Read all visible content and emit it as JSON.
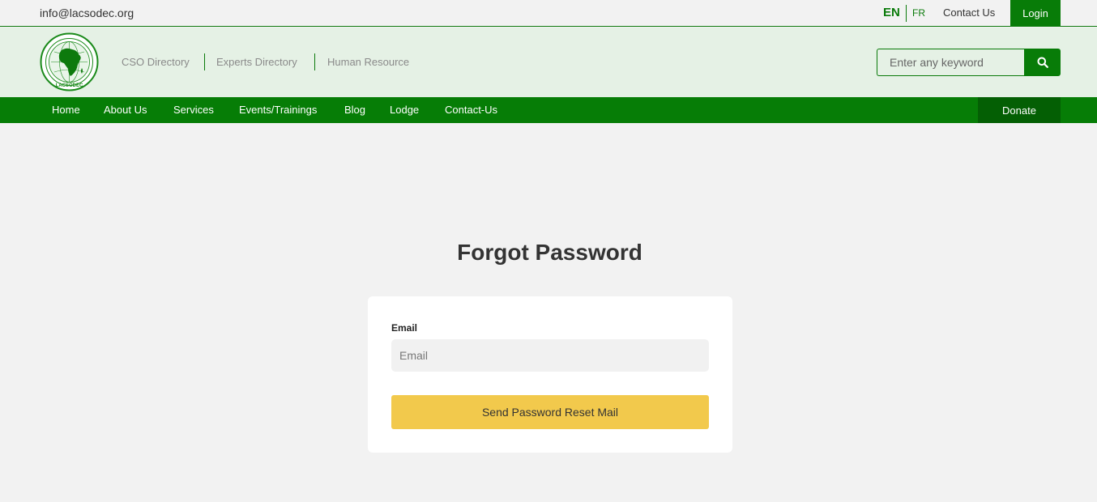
{
  "topbar": {
    "email": "info@lacsodec.org",
    "lang_en": "EN",
    "lang_fr": "FR",
    "contact_label": "Contact Us",
    "login_label": "Login"
  },
  "header": {
    "logo_text": "LACSODEC",
    "directory_links": [
      "CSO Directory",
      "Experts Directory",
      "Human Resource"
    ],
    "search_placeholder": "Enter any keyword"
  },
  "nav": {
    "items": [
      "Home",
      "About Us",
      "Services",
      "Events/Trainings",
      "Blog",
      "Lodge",
      "Contact-Us"
    ],
    "donate_label": "Donate"
  },
  "main": {
    "title": "Forgot Password",
    "email_label": "Email",
    "email_placeholder": "Email",
    "submit_label": "Send Password Reset Mail"
  },
  "colors": {
    "brand_green": "#087c08",
    "dark_green": "#045f04",
    "header_bg": "#e5f1e5",
    "button_yellow": "#f2c94c",
    "page_bg": "#f2f2f2"
  }
}
